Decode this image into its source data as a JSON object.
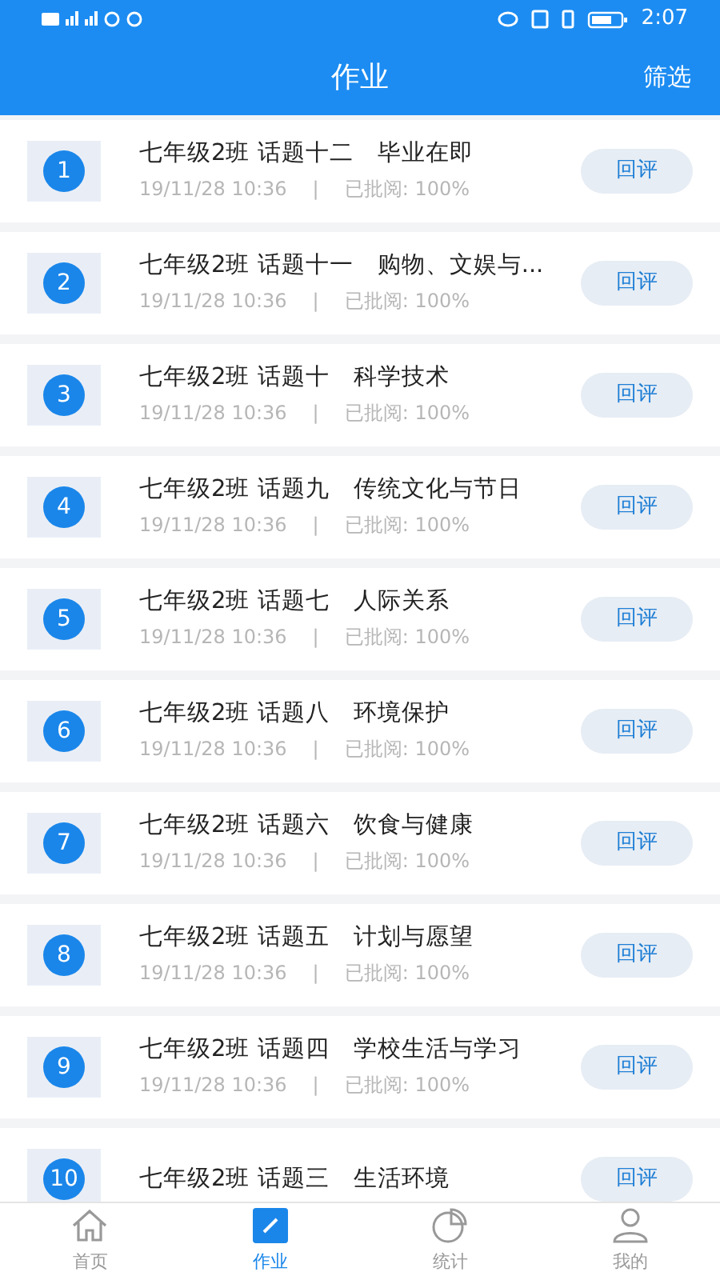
{
  "status_bar": {
    "time": "2:07"
  },
  "header": {
    "title": "作业",
    "action": "筛选"
  },
  "assignments": [
    {
      "number": "1",
      "title": "七年级2班 话题十二　毕业在即",
      "date": "19/11/28 10:36",
      "separator": "|",
      "reviewed": "已批阅:  100%",
      "button": "回评"
    },
    {
      "number": "2",
      "title": "七年级2班 话题十一　购物、文娱与...",
      "date": "19/11/28 10:36",
      "separator": "|",
      "reviewed": "已批阅:  100%",
      "button": "回评"
    },
    {
      "number": "3",
      "title": "七年级2班 话题十　科学技术",
      "date": "19/11/28 10:36",
      "separator": "|",
      "reviewed": "已批阅:  100%",
      "button": "回评"
    },
    {
      "number": "4",
      "title": "七年级2班 话题九　传统文化与节日",
      "date": "19/11/28 10:36",
      "separator": "|",
      "reviewed": "已批阅:  100%",
      "button": "回评"
    },
    {
      "number": "5",
      "title": "七年级2班 话题七　人际关系",
      "date": "19/11/28 10:36",
      "separator": "|",
      "reviewed": "已批阅:  100%",
      "button": "回评"
    },
    {
      "number": "6",
      "title": "七年级2班 话题八　环境保护",
      "date": "19/11/28 10:36",
      "separator": "|",
      "reviewed": "已批阅:  100%",
      "button": "回评"
    },
    {
      "number": "7",
      "title": "七年级2班 话题六　饮食与健康",
      "date": "19/11/28 10:36",
      "separator": "|",
      "reviewed": "已批阅:  100%",
      "button": "回评"
    },
    {
      "number": "8",
      "title": "七年级2班 话题五　计划与愿望",
      "date": "19/11/28 10:36",
      "separator": "|",
      "reviewed": "已批阅:  100%",
      "button": "回评"
    },
    {
      "number": "9",
      "title": "七年级2班 话题四　学校生活与学习",
      "date": "19/11/28 10:36",
      "separator": "|",
      "reviewed": "已批阅:  100%",
      "button": "回评"
    },
    {
      "number": "10",
      "title": "七年级2班 话题三　生活环境",
      "button": "回评"
    }
  ],
  "tab_bar": [
    {
      "label": "首页",
      "kind": "home",
      "selected": false
    },
    {
      "label": "作业",
      "kind": "edit",
      "selected": true
    },
    {
      "label": "统计",
      "kind": "chart",
      "selected": false
    },
    {
      "label": "我的",
      "kind": "person",
      "selected": false
    }
  ]
}
